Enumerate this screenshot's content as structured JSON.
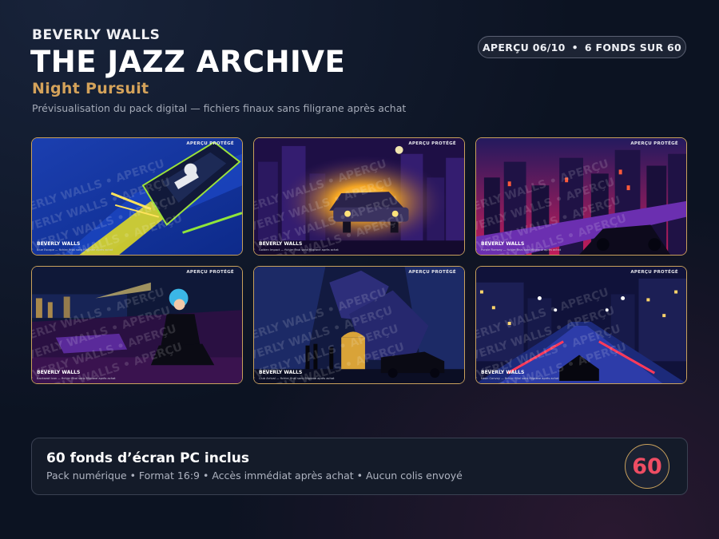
{
  "header": {
    "brand": "BEVERLY WALLS",
    "title": "THE JAZZ ARCHIVE",
    "subtitle": "Night Pursuit",
    "description": "Prévisualisation du pack digital — fichiers finaux sans filigrane après achat"
  },
  "badge": {
    "preview": "APERÇU 06/10",
    "separator": "•",
    "count": "6 FONDS SUR 60"
  },
  "cards": [
    {
      "brand": "BEVERLY WALLS",
      "protected": "APERÇU PROTÉGÉ",
      "info": "Blue Escape — fichier final sans filigrane après achat",
      "watermark": "BEVERLY WALLS • APERÇU"
    },
    {
      "brand": "BEVERLY WALLS",
      "protected": "APERÇU PROTÉGÉ",
      "info": "Golden Impact — fichier final sans filigrane après achat",
      "watermark": "BEVERLY WALLS • APERÇU"
    },
    {
      "brand": "BEVERLY WALLS",
      "protected": "APERÇU PROTÉGÉ",
      "info": "Purple Runway — fichier final sans filigrane après achat",
      "watermark": "BEVERLY WALLS • APERÇU"
    },
    {
      "brand": "BEVERLY WALLS",
      "protected": "APERÇU PROTÉGÉ",
      "info": "Backseat Icon — fichier final sans filigrane après achat",
      "watermark": "BEVERLY WALLS • APERÇU"
    },
    {
      "brand": "BEVERLY WALLS",
      "protected": "APERÇU PROTÉGÉ",
      "info": "Club Arrival — fichier final sans filigrane après achat",
      "watermark": "BEVERLY WALLS • APERÇU"
    },
    {
      "brand": "BEVERLY WALLS",
      "protected": "APERÇU PROTÉGÉ",
      "info": "Neon Convoy — fichier final sans filigrane après achat",
      "watermark": "BEVERLY WALLS • APERÇU"
    }
  ],
  "footer": {
    "title": "60 fonds d’écran PC inclus",
    "info": "Pack numérique • Format 16:9 • Accès immédiat après achat • Aucun colis envoyé",
    "count": "60"
  },
  "colors": {
    "background": "#0c1322",
    "gold_accent": "#d4a25a",
    "card_border": "#c9a15c",
    "count_red": "#ee4d63"
  }
}
